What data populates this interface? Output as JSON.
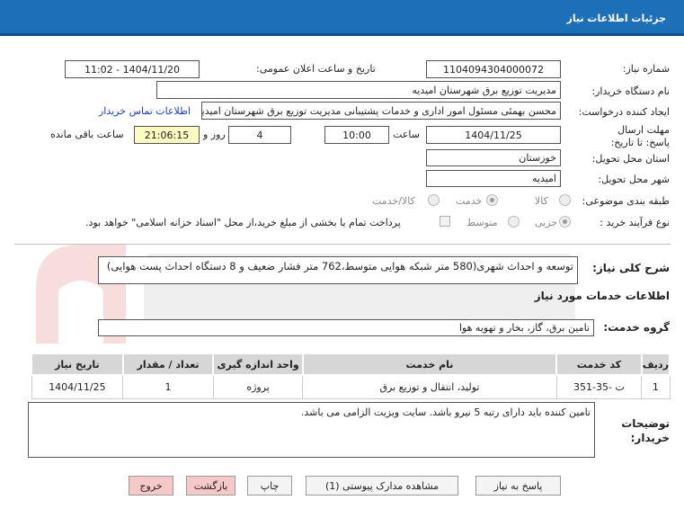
{
  "header": {
    "title": "جزئیات اطلاعات نیاز"
  },
  "need_number": {
    "label": "شماره نیاز:",
    "value": "1104094304000072"
  },
  "announce_datetime": {
    "label": "تاریخ و ساعت اعلان عمومی:",
    "value": "1404/11/20 - 11:02"
  },
  "buyer_org": {
    "label": "نام دستگاه خریدار:",
    "value": "مدیریت توزیع برق شهرستان امیدیه"
  },
  "requester": {
    "label": "ایجاد کننده درخواست:",
    "value": "محسن بهمئی مسئول امور اداری و خدمات پشتیبانی مدیریت توزیع برق شهرستان امیدیه",
    "contact_link": "اطلاعات تماس خریدار"
  },
  "deadline": {
    "label": "مهلت ارسال پاسخ: تا تاریخ:",
    "date": "1404/11/25",
    "time_label": "ساعت",
    "time": "10:00",
    "days": "4",
    "days_label": "روز و",
    "remaining": "21:06:15",
    "remaining_label": "ساعت باقی مانده"
  },
  "province": {
    "label": "استان محل تحویل:",
    "value": "خوزستان"
  },
  "city": {
    "label": "شهر محل تحویل:",
    "value": "امیدیه"
  },
  "category": {
    "label": "طبقه بندی موضوعی:",
    "options": [
      "کالا",
      "خدمت",
      "کالا/خدمت"
    ],
    "selected": "خدمت"
  },
  "purchase_type": {
    "label": "نوع فرآیند خرید :",
    "options": [
      "جزیی",
      "متوسط"
    ],
    "selected": "جزیی",
    "payment_note": "پرداخت تمام یا بخشی از مبلغ خرید،از محل \"اسناد خزانه اسلامی\" خواهد بود."
  },
  "description": {
    "label": "شرح کلی نیاز:",
    "value": "توسعه و احداث شهری(580 متر شبکه هوایی متوسط،762 متر فشار ضعیف و 8 دستگاه احداث پست هوایی)"
  },
  "services_section": {
    "title": "اطلاعات خدمات مورد نیاز"
  },
  "service_group": {
    "label": "گروه خدمت:",
    "value": "تامین برق، گاز، بخار و تهویه هوا"
  },
  "table": {
    "headers": [
      "ردیف",
      "کد خدمت",
      "نام خدمت",
      "واحد اندازه گیری",
      "تعداد / مقدار",
      "تاریخ نیاز"
    ],
    "rows": [
      [
        "1",
        "ت -35-351",
        "تولید، انتقال و توزیع برق",
        "پروژه",
        "1",
        "1404/11/25"
      ]
    ]
  },
  "buyer_notes": {
    "label_line1": "توضیحات",
    "label_line2": "خریدار:",
    "value": "تامین کننده باید دارای رتبه 5 نیرو باشد. سایت ویزیت الزامی می باشد."
  },
  "buttons": {
    "reply": "پاسخ به نیاز",
    "attachments": "مشاهده مدارک پیوستی (1)",
    "print": "چاپ",
    "back": "بازگشت",
    "exit": "خروج"
  }
}
